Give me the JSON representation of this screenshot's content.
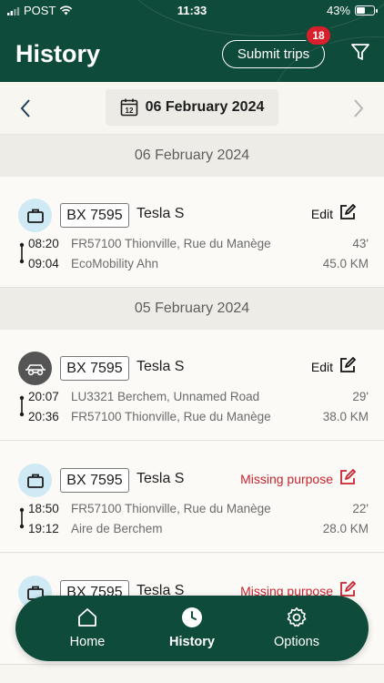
{
  "status_bar": {
    "carrier": "POST",
    "time": "11:33",
    "battery": "43%"
  },
  "header": {
    "title": "History",
    "submit_label": "Submit trips",
    "badge_count": "18"
  },
  "date_nav": {
    "date": "06 February 2024",
    "calendar_day": "12"
  },
  "sections": [
    {
      "label": "06 February 2024"
    },
    {
      "label": "05 February 2024"
    }
  ],
  "trips": [
    {
      "purpose_icon": "briefcase-icon",
      "plate": "BX 7595",
      "car": "Tesla S",
      "action": "Edit",
      "start_time": "08:20",
      "start_place": "FR57100 Thionville, Rue du Manège",
      "end_time": "09:04",
      "end_place": "EcoMobility Ahn",
      "duration": "43'",
      "distance": "45.0 KM"
    },
    {
      "purpose_icon": "private-car-icon",
      "plate": "BX 7595",
      "car": "Tesla S",
      "action": "Edit",
      "start_time": "20:07",
      "start_place": "LU3321 Berchem, Unnamed Road",
      "end_time": "20:36",
      "end_place": "FR57100 Thionville, Rue du Manège",
      "duration": "29'",
      "distance": "38.0 KM"
    },
    {
      "purpose_icon": "briefcase-icon",
      "plate": "BX 7595",
      "car": "Tesla S",
      "action": "Missing purpose",
      "start_time": "18:50",
      "start_place": "FR57100 Thionville, Rue du Manège",
      "end_time": "19:12",
      "end_place": "Aire de Berchem",
      "duration": "22'",
      "distance": "28.0 KM"
    },
    {
      "purpose_icon": "briefcase-icon",
      "plate": "BX 7595",
      "car": "Tesla S",
      "action": "Missing purpose"
    }
  ],
  "tabbar": {
    "items": [
      {
        "label": "Home",
        "icon": "home-icon"
      },
      {
        "label": "History",
        "icon": "clock-icon",
        "active": true
      },
      {
        "label": "Options",
        "icon": "gear-icon"
      }
    ]
  },
  "colors": {
    "brand_green": "#0f4b3a",
    "alert_red": "#c8232e",
    "badge_red": "#d8202c"
  }
}
